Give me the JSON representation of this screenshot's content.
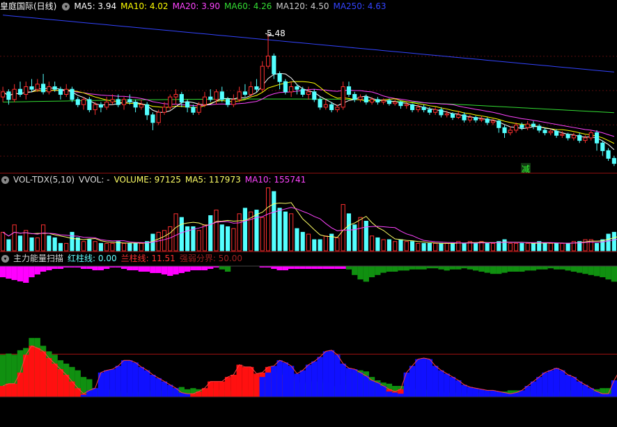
{
  "main": {
    "title": "皇庭国际(日线)",
    "ma": [
      {
        "label": "MA5: 3.94",
        "color": "#ffffff"
      },
      {
        "label": "MA10: 4.02",
        "color": "#ffff00"
      },
      {
        "label": "MA20: 3.90",
        "color": "#ff44ff"
      },
      {
        "label": "MA60: 4.26",
        "color": "#33dd33"
      },
      {
        "label": "MA120: 4.50",
        "color": "#cccccc"
      },
      {
        "label": "MA250: 4.63",
        "color": "#3344ff"
      }
    ],
    "high_label": "5.48",
    "signal_label": "减"
  },
  "volume": {
    "title": "VOL-TDX(5,10)",
    "vvol": "VVOL: -",
    "volume": "VOLUME: 97125",
    "ma5": "MA5: 117973",
    "ma10": "MA10: 155741"
  },
  "scanner": {
    "title": "主力能量扫描",
    "red_line": "红柱线: 0.00",
    "blue_line": "兰柱线: 11.51",
    "divide": "强弱分界: 50.00"
  },
  "colors": {
    "up": "#ff3030",
    "down": "#54ffff",
    "ma5": "#ffffff",
    "ma10": "#ffff00",
    "ma20": "#ff44ff",
    "ma60": "#33dd33",
    "ma250": "#3344ff",
    "mag": "#ff00ff",
    "green": "#109010",
    "red": "#ff1010",
    "blue": "#1010ff"
  },
  "chart_data": {
    "type": "candlestick",
    "candles": [
      [
        4.25,
        4.35,
        4.45,
        4.15
      ],
      [
        4.35,
        4.2,
        4.4,
        4.1
      ],
      [
        4.2,
        4.4,
        4.5,
        4.15
      ],
      [
        4.4,
        4.3,
        4.55,
        4.25
      ],
      [
        4.3,
        4.45,
        4.55,
        4.2
      ],
      [
        4.45,
        4.4,
        4.6,
        4.35
      ],
      [
        4.4,
        4.5,
        4.6,
        4.35
      ],
      [
        4.5,
        4.35,
        4.7,
        4.3
      ],
      [
        4.35,
        4.45,
        4.55,
        4.3
      ],
      [
        4.45,
        4.4,
        4.55,
        4.35
      ],
      [
        4.4,
        4.3,
        4.45,
        4.2
      ],
      [
        4.3,
        4.4,
        4.5,
        4.25
      ],
      [
        4.4,
        4.2,
        4.45,
        4.15
      ],
      [
        4.2,
        4.1,
        4.25,
        4.05
      ],
      [
        4.1,
        4.2,
        4.25,
        4.0
      ],
      [
        4.2,
        4.0,
        4.25,
        3.95
      ],
      [
        4.0,
        4.1,
        4.15,
        3.9
      ],
      [
        4.1,
        4.05,
        4.15,
        3.95
      ],
      [
        4.05,
        4.15,
        4.25,
        4.0
      ],
      [
        4.15,
        4.2,
        4.3,
        4.1
      ],
      [
        4.2,
        4.1,
        4.3,
        4.05
      ],
      [
        4.1,
        4.2,
        4.25,
        4.0
      ],
      [
        4.2,
        4.15,
        4.3,
        4.1
      ],
      [
        4.15,
        4.05,
        4.2,
        3.95
      ],
      [
        4.05,
        4.1,
        4.2,
        4.0
      ],
      [
        4.1,
        3.9,
        4.15,
        3.8
      ],
      [
        3.9,
        3.75,
        3.95,
        3.6
      ],
      [
        3.75,
        3.95,
        4.0,
        3.7
      ],
      [
        3.95,
        4.05,
        4.15,
        3.9
      ],
      [
        4.05,
        4.25,
        4.3,
        4.0
      ],
      [
        4.25,
        4.3,
        4.4,
        4.1
      ],
      [
        4.3,
        4.15,
        4.35,
        4.05
      ],
      [
        4.15,
        4.05,
        4.2,
        3.95
      ],
      [
        4.05,
        3.95,
        4.1,
        3.9
      ],
      [
        3.95,
        4.1,
        4.15,
        3.9
      ],
      [
        4.1,
        4.25,
        4.35,
        4.05
      ],
      [
        4.25,
        4.2,
        4.4,
        4.15
      ],
      [
        4.2,
        4.35,
        4.4,
        4.1
      ],
      [
        4.35,
        4.2,
        4.45,
        4.15
      ],
      [
        4.2,
        4.1,
        4.25,
        4.05
      ],
      [
        4.1,
        4.2,
        4.3,
        4.05
      ],
      [
        4.2,
        4.35,
        4.45,
        4.15
      ],
      [
        4.35,
        4.3,
        4.5,
        4.25
      ],
      [
        4.3,
        4.45,
        4.55,
        4.25
      ],
      [
        4.45,
        4.4,
        4.6,
        4.35
      ],
      [
        4.4,
        4.85,
        4.95,
        4.35
      ],
      [
        4.85,
        5.05,
        5.48,
        4.8
      ],
      [
        5.05,
        4.7,
        5.1,
        4.6
      ],
      [
        4.7,
        4.55,
        4.75,
        4.4
      ],
      [
        4.55,
        4.35,
        4.6,
        4.3
      ],
      [
        4.35,
        4.45,
        4.55,
        4.25
      ],
      [
        4.45,
        4.4,
        4.5,
        4.3
      ],
      [
        4.4,
        4.3,
        4.45,
        4.25
      ],
      [
        4.3,
        4.35,
        4.45,
        4.2
      ],
      [
        4.35,
        4.2,
        4.4,
        4.15
      ],
      [
        4.2,
        4.05,
        4.25,
        4.0
      ],
      [
        4.05,
        4.1,
        4.2,
        4.0
      ],
      [
        4.1,
        4.0,
        4.15,
        3.95
      ],
      [
        4.0,
        4.05,
        4.1,
        3.95
      ],
      [
        4.05,
        4.45,
        4.55,
        4.0
      ],
      [
        4.45,
        4.3,
        4.55,
        4.25
      ],
      [
        4.3,
        4.2,
        4.35,
        4.15
      ],
      [
        4.2,
        4.25,
        4.3,
        4.15
      ],
      [
        4.25,
        4.15,
        4.3,
        4.1
      ],
      [
        4.15,
        4.2,
        4.25,
        4.1
      ],
      [
        4.2,
        4.15,
        4.25,
        4.1
      ],
      [
        4.15,
        4.18,
        4.22,
        4.1
      ],
      [
        4.18,
        4.12,
        4.22,
        4.08
      ],
      [
        4.12,
        4.15,
        4.2,
        4.08
      ],
      [
        4.15,
        4.08,
        4.18,
        4.02
      ],
      [
        4.08,
        4.1,
        4.15,
        4.02
      ],
      [
        4.1,
        4.0,
        4.12,
        3.95
      ],
      [
        4.0,
        4.05,
        4.1,
        3.95
      ],
      [
        4.05,
        4.0,
        4.1,
        3.95
      ],
      [
        4.0,
        3.95,
        4.05,
        3.9
      ],
      [
        3.95,
        4.0,
        4.05,
        3.9
      ],
      [
        4.0,
        3.9,
        4.05,
        3.85
      ],
      [
        3.9,
        3.92,
        3.98,
        3.85
      ],
      [
        3.92,
        3.85,
        3.95,
        3.8
      ],
      [
        3.85,
        3.9,
        3.98,
        3.82
      ],
      [
        3.9,
        3.8,
        3.95,
        3.75
      ],
      [
        3.8,
        3.85,
        3.9,
        3.75
      ],
      [
        3.85,
        3.8,
        3.88,
        3.75
      ],
      [
        3.8,
        3.82,
        3.88,
        3.76
      ],
      [
        3.82,
        3.75,
        3.85,
        3.7
      ],
      [
        3.75,
        3.78,
        3.82,
        3.7
      ],
      [
        3.78,
        3.65,
        3.8,
        3.55
      ],
      [
        3.65,
        3.55,
        3.7,
        3.45
      ],
      [
        3.55,
        3.6,
        3.68,
        3.5
      ],
      [
        3.6,
        3.7,
        3.75,
        3.55
      ],
      [
        3.7,
        3.65,
        3.75,
        3.6
      ],
      [
        3.65,
        3.72,
        3.78,
        3.6
      ],
      [
        3.72,
        3.68,
        3.78,
        3.62
      ],
      [
        3.68,
        3.6,
        3.72,
        3.55
      ],
      [
        3.6,
        3.55,
        3.65,
        3.5
      ],
      [
        3.55,
        3.58,
        3.62,
        3.5
      ],
      [
        3.58,
        3.5,
        3.62,
        3.45
      ],
      [
        3.5,
        3.52,
        3.58,
        3.45
      ],
      [
        3.52,
        3.45,
        3.55,
        3.4
      ],
      [
        3.45,
        3.5,
        3.55,
        3.4
      ],
      [
        3.5,
        3.4,
        3.55,
        3.35
      ],
      [
        3.4,
        3.45,
        3.5,
        3.35
      ],
      [
        3.45,
        3.55,
        3.6,
        3.4
      ],
      [
        3.55,
        3.35,
        3.6,
        3.2
      ],
      [
        3.35,
        3.2,
        3.4,
        3.1
      ],
      [
        3.2,
        3.05,
        3.25,
        3.0
      ],
      [
        3.05,
        2.95,
        3.1,
        2.9
      ]
    ],
    "volume": [
      100,
      60,
      140,
      80,
      110,
      70,
      70,
      140,
      80,
      70,
      40,
      40,
      100,
      70,
      50,
      60,
      50,
      40,
      40,
      40,
      50,
      40,
      40,
      40,
      40,
      50,
      90,
      100,
      110,
      130,
      200,
      180,
      130,
      130,
      110,
      140,
      190,
      220,
      140,
      130,
      120,
      200,
      230,
      210,
      220,
      180,
      340,
      320,
      230,
      210,
      200,
      120,
      100,
      90,
      60,
      60,
      80,
      90,
      70,
      250,
      200,
      140,
      180,
      160,
      80,
      70,
      60,
      60,
      50,
      60,
      50,
      50,
      40,
      40,
      40,
      40,
      40,
      40,
      40,
      50,
      40,
      50,
      40,
      50,
      40,
      40,
      50,
      60,
      40,
      40,
      40,
      40,
      40,
      50,
      40,
      40,
      40,
      40,
      40,
      50,
      50,
      60,
      60,
      40,
      60,
      90,
      100,
      110,
      90,
      80
    ],
    "volume_up": [
      1,
      0,
      1,
      0,
      1,
      0,
      1,
      1,
      0,
      0,
      0,
      1,
      0,
      0,
      1,
      0,
      1,
      0,
      1,
      1,
      0,
      1,
      0,
      0,
      1,
      0,
      0,
      1,
      1,
      1,
      1,
      0,
      0,
      0,
      1,
      1,
      0,
      1,
      0,
      0,
      1,
      1,
      0,
      1,
      0,
      1,
      1,
      0,
      0,
      0,
      1,
      0,
      0,
      1,
      0,
      0,
      1,
      0,
      1,
      1,
      0,
      0,
      1,
      0,
      1,
      0,
      1,
      0,
      1,
      0,
      1,
      0,
      1,
      0,
      0,
      1,
      0,
      1,
      0,
      1,
      0,
      1,
      0,
      1,
      0,
      1,
      0,
      0,
      1,
      1,
      0,
      1,
      0,
      0,
      0,
      1,
      0,
      1,
      0,
      1,
      0,
      1,
      1,
      0,
      0,
      0,
      0,
      0,
      0,
      0
    ],
    "scanner": {
      "green": [
        38,
        39,
        38,
        42,
        44,
        53,
        53,
        46,
        41,
        38,
        33,
        30,
        27,
        24,
        18,
        16,
        8,
        7,
        7,
        6,
        5,
        4,
        4,
        4,
        5,
        5,
        6,
        6,
        6,
        6,
        8,
        9,
        7,
        8,
        7,
        7,
        8,
        7,
        6,
        5,
        6,
        6,
        7,
        6,
        6,
        12,
        14,
        23,
        26,
        21,
        18,
        14,
        13,
        12,
        14,
        16,
        13,
        10,
        9,
        11,
        19,
        22,
        24,
        23,
        18,
        15,
        13,
        12,
        10,
        10,
        9,
        8,
        7,
        7,
        6,
        5,
        5,
        4,
        4,
        4,
        4,
        3,
        4,
        4,
        3,
        3,
        4,
        5,
        6,
        6,
        6,
        5,
        4,
        3,
        4,
        4,
        4,
        5,
        5,
        6,
        6,
        6,
        7,
        7,
        8,
        8,
        9,
        10,
        13,
        18
      ],
      "red": [
        10,
        12,
        12,
        22,
        38,
        46,
        44,
        41,
        35,
        30,
        25,
        20,
        14,
        8,
        3,
        0,
        0,
        0,
        0,
        0,
        0,
        0,
        0,
        0,
        0,
        0,
        0,
        0,
        0,
        0,
        0,
        0,
        0,
        3,
        5,
        8,
        14,
        14,
        14,
        18,
        20,
        29,
        27,
        27,
        21,
        22,
        27,
        22,
        20,
        20,
        18,
        0,
        0,
        0,
        0,
        0,
        0,
        0,
        0,
        0,
        0,
        0,
        0,
        0,
        0,
        0,
        3,
        7,
        5,
        7,
        0,
        0,
        0,
        0,
        0,
        0,
        0,
        0,
        0,
        0,
        0,
        0,
        0,
        0,
        0,
        0,
        0,
        0,
        0,
        0,
        0,
        0,
        0,
        0,
        0,
        0,
        0,
        0,
        0,
        0,
        0,
        0,
        0,
        0,
        0,
        0,
        0,
        0,
        0,
        0
      ],
      "blue": [
        0,
        0,
        0,
        0,
        0,
        0,
        0,
        0,
        0,
        0,
        0,
        0,
        0,
        0,
        2,
        6,
        8,
        22,
        24,
        25,
        28,
        33,
        33,
        31,
        27,
        24,
        20,
        17,
        14,
        11,
        8,
        4,
        3,
        0,
        0,
        0,
        0,
        0,
        0,
        0,
        0,
        0,
        0,
        0,
        0,
        18,
        22,
        28,
        33,
        31,
        28,
        21,
        24,
        29,
        32,
        36,
        41,
        42,
        38,
        30,
        26,
        25,
        22,
        19,
        15,
        13,
        10,
        5,
        4,
        3,
        22,
        28,
        34,
        35,
        34,
        28,
        24,
        21,
        18,
        15,
        11,
        9,
        8,
        7,
        6,
        6,
        5,
        4,
        3,
        4,
        6,
        10,
        14,
        18,
        22,
        24,
        26,
        24,
        20,
        18,
        14,
        11,
        8,
        5,
        3,
        3,
        15,
        24,
        34,
        44
      ],
      "top_mag": [
        8,
        9,
        10,
        11,
        12,
        8,
        6,
        4,
        3,
        2,
        2,
        1,
        1,
        1,
        2,
        2,
        3,
        3,
        2,
        1,
        1,
        2,
        3,
        3,
        4,
        4,
        5,
        5,
        6,
        7,
        6,
        5,
        4,
        3,
        3,
        3,
        2,
        1,
        0,
        0,
        0,
        0,
        0,
        0,
        0,
        1,
        1,
        2,
        3,
        3,
        2,
        2,
        2,
        2,
        2,
        2,
        2,
        2,
        2,
        2,
        0,
        0,
        0,
        0,
        0,
        0,
        0,
        0,
        0,
        0,
        0,
        0,
        0,
        0,
        0,
        0,
        0,
        0,
        0,
        0,
        0,
        0,
        0,
        0,
        0,
        0,
        0,
        0,
        0,
        0,
        0,
        0,
        0,
        0,
        0,
        0,
        0,
        0,
        0,
        0,
        0,
        0,
        0,
        0,
        0,
        0,
        0,
        0,
        0,
        0
      ],
      "top_green": [
        0,
        0,
        0,
        0,
        0,
        0,
        0,
        0,
        0,
        0,
        0,
        0,
        0,
        0,
        0,
        0,
        0,
        0,
        0,
        0,
        0,
        0,
        0,
        0,
        0,
        0,
        0,
        0,
        0,
        0,
        0,
        0,
        0,
        0,
        0,
        0,
        0,
        0,
        3,
        5,
        0,
        0,
        0,
        0,
        0,
        0,
        0,
        0,
        0,
        0,
        0,
        0,
        0,
        0,
        0,
        0,
        0,
        0,
        0,
        0,
        3,
        8,
        12,
        14,
        10,
        8,
        6,
        5,
        5,
        4,
        4,
        3,
        3,
        3,
        2,
        2,
        3,
        4,
        3,
        3,
        2,
        3,
        4,
        5,
        6,
        7,
        7,
        6,
        5,
        5,
        5,
        4,
        4,
        3,
        3,
        2,
        3,
        3,
        4,
        5,
        6,
        7,
        8,
        9,
        10,
        12,
        14,
        13,
        12,
        12
      ]
    }
  }
}
